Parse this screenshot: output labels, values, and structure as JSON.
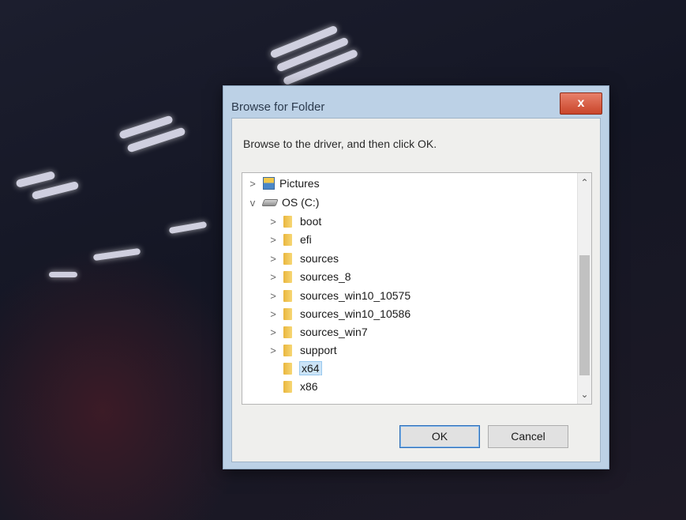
{
  "dialog": {
    "title": "Browse for Folder",
    "close_label": "x",
    "instruction": "Browse to the driver, and then click OK.",
    "ok_label": "OK",
    "cancel_label": "Cancel"
  },
  "tree": {
    "items": [
      {
        "label": "Pictures",
        "chevron": ">",
        "icon": "pictures-icon"
      },
      {
        "label": "OS (C:)",
        "chevron": "v",
        "icon": "drive-icon"
      },
      {
        "label": "boot",
        "chevron": ">",
        "icon": "folder-icon"
      },
      {
        "label": "efi",
        "chevron": ">",
        "icon": "folder-icon"
      },
      {
        "label": "sources",
        "chevron": ">",
        "icon": "folder-icon"
      },
      {
        "label": "sources_8",
        "chevron": ">",
        "icon": "folder-icon"
      },
      {
        "label": "sources_win10_10575",
        "chevron": ">",
        "icon": "folder-icon"
      },
      {
        "label": "sources_win10_10586",
        "chevron": ">",
        "icon": "folder-icon"
      },
      {
        "label": "sources_win7",
        "chevron": ">",
        "icon": "folder-icon"
      },
      {
        "label": "support",
        "chevron": ">",
        "icon": "folder-icon"
      },
      {
        "label": "x64",
        "chevron": "",
        "icon": "folder-icon",
        "selected": true
      },
      {
        "label": "x86",
        "chevron": "",
        "icon": "folder-icon"
      }
    ]
  },
  "scrollbar": {
    "up_icon": "chevron-up-icon",
    "down_icon": "chevron-down-icon"
  },
  "colors": {
    "close_button": "#c9452a",
    "selection": "#cce4f7",
    "ok_border": "#2f6fb8"
  }
}
